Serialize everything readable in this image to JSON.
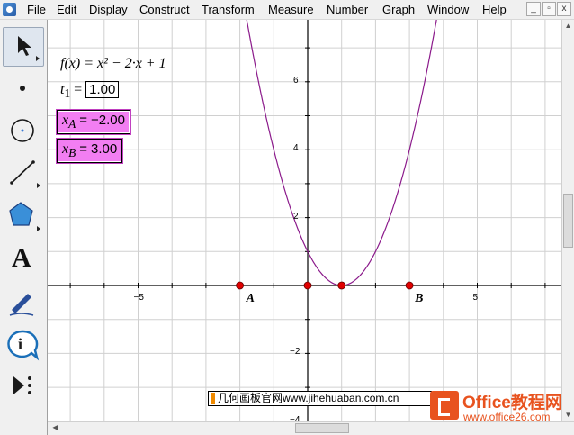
{
  "menubar": {
    "items": [
      "File",
      "Edit",
      "Display",
      "Construct",
      "Transform",
      "Measure",
      "Number",
      "Graph",
      "Window",
      "Help"
    ],
    "window_buttons": [
      "_",
      "▫",
      "x"
    ]
  },
  "toolbar": {
    "tools": [
      {
        "name": "select-arrow-tool",
        "icon": "arrow-icon"
      },
      {
        "name": "point-tool",
        "icon": "dot-icon"
      },
      {
        "name": "compass-tool",
        "icon": "circle-icon"
      },
      {
        "name": "straightedge-tool",
        "icon": "line-segment-icon"
      },
      {
        "name": "polygon-tool",
        "icon": "pentagon-icon"
      },
      {
        "name": "text-tool",
        "icon": "letter-a-icon",
        "glyph": "A"
      },
      {
        "name": "marker-tool",
        "icon": "pen-icon"
      },
      {
        "name": "information-tool",
        "icon": "info-icon",
        "glyph": "i"
      },
      {
        "name": "custom-tool",
        "icon": "play-more-icon"
      }
    ]
  },
  "sketch": {
    "function": {
      "name": "f",
      "var": "x",
      "text": "f(x) = x² − 2·x + 1"
    },
    "t1": {
      "name": "t",
      "sub": "1",
      "value": "1.00"
    },
    "xA": {
      "name": "x",
      "sub": "A",
      "value": "−2.00"
    },
    "xB": {
      "name": "x",
      "sub": "B",
      "value": "3.00"
    },
    "point_labels": {
      "A": "A",
      "B": "B"
    }
  },
  "chart_data": {
    "type": "line",
    "series": [
      {
        "name": "f(x)",
        "expr": "x^2 - 2x + 1"
      }
    ],
    "points": [
      {
        "label": "A",
        "x": -2,
        "y": 0
      },
      {
        "label": "",
        "x": 0,
        "y": 0
      },
      {
        "label": "",
        "x": 1,
        "y": 0
      },
      {
        "label": "B",
        "x": 3,
        "y": 0
      }
    ],
    "xlim": [
      -7.5,
      7.5
    ],
    "ylim": [
      -4,
      7.5
    ],
    "x_ticks": [
      -5,
      5
    ],
    "y_ticks": [
      6,
      4,
      2,
      -2,
      -4
    ],
    "grid": true,
    "colors": {
      "curve": "#8b1a8b",
      "point": "#e00000",
      "grid": "#d0d0d0"
    }
  },
  "watermarks": {
    "left": "几何画板官网www.jihehuaban.com.cn",
    "brand": "Office教程网",
    "url": "www.office26.com"
  }
}
